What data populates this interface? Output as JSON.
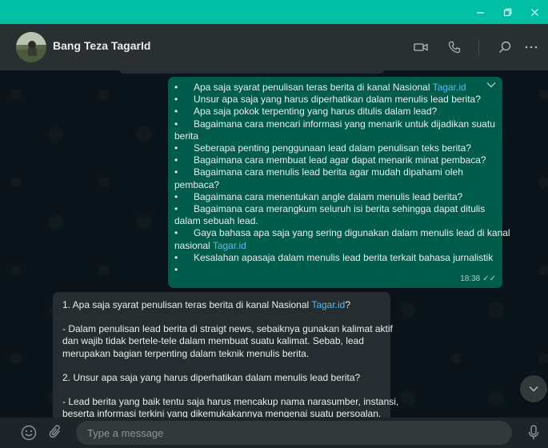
{
  "window": {
    "minimize_icon": "minimize-icon",
    "restore_icon": "restore-icon",
    "close_icon": "close-icon",
    "titlebar_color": "#00bfa5"
  },
  "header": {
    "contact_name": "Bang Teza TagarId",
    "icons": [
      "video-call-icon",
      "voice-call-icon",
      "search-icon",
      "menu-icon"
    ]
  },
  "outgoing": {
    "bullet": "•",
    "items": [
      {
        "text": "Apa saja syarat penulisan teras berita di kanal Nasional ",
        "link": "Tagar.id"
      },
      {
        "text": "Unsur apa saja yang harus diperhatikan dalam menulis lead berita?"
      },
      {
        "text": "Apa saja pokok terpenting yang harus ditulis dalam lead?"
      },
      {
        "text": "Bagaimana cara mencari informasi yang menarik untuk dijadikan suatu",
        "cont": "berita"
      },
      {
        "text": "Seberapa penting penggunaan lead dalam penulisan teks berita?"
      },
      {
        "text": "Bagaimana cara membuat lead agar dapat menarik minat pembaca?"
      },
      {
        "text": "Bagaimana cara menulis lead berita agar mudah dipahami oleh",
        "cont": "pembaca?"
      },
      {
        "text": "Bagaimana cara menentukan angle dalam menulis lead berita?"
      },
      {
        "text": "Bagaimana cara merangkum seluruh isi berita sehingga dapat ditulis",
        "cont": "dalam sebuah lead."
      },
      {
        "text": "Gaya bahasa apa saja yang sering digunakan dalam menulis lead di kanal",
        "cont": "nasional ",
        "cont_link": "Tagar.id"
      },
      {
        "text": "Kesalahan apasaja dalam menulis lead berita terkait bahasa jurnalistik"
      },
      {
        "text": ""
      }
    ],
    "time": "18:38",
    "status": "read",
    "bubble_color": "#005c4b"
  },
  "incoming": {
    "q1_text": "1. Apa saja syarat penulisan teras berita di kanal Nasional ",
    "q1_link": "Tagar.id",
    "q1_end": "?",
    "a1_lines": [
      "- Dalam penulisan lead berita di straigt news, sebaiknya gunakan kalimat aktif",
      "dan wajib tidak bertele-tele dalam membuat suatu kalimat. Sebab, lead",
      "merupakan bagian terpenting dalam teknik menulis berita."
    ],
    "q2": "2. Unsur apa saja yang harus diperhatikan dalam menulis lead berita?",
    "a2_lines": [
      "- Lead berita yang baik tentu saja harus mencakup nama narasumber, instansi,",
      "beserta informasi terkini yang dikemukakannya mengenai suatu persoalan."
    ],
    "bubble_color": "#262d31"
  },
  "composer": {
    "placeholder": "Type a message",
    "icons": [
      "emoji-icon",
      "attach-icon",
      "microphone-icon"
    ]
  },
  "accent_link_color": "#53bdeb"
}
